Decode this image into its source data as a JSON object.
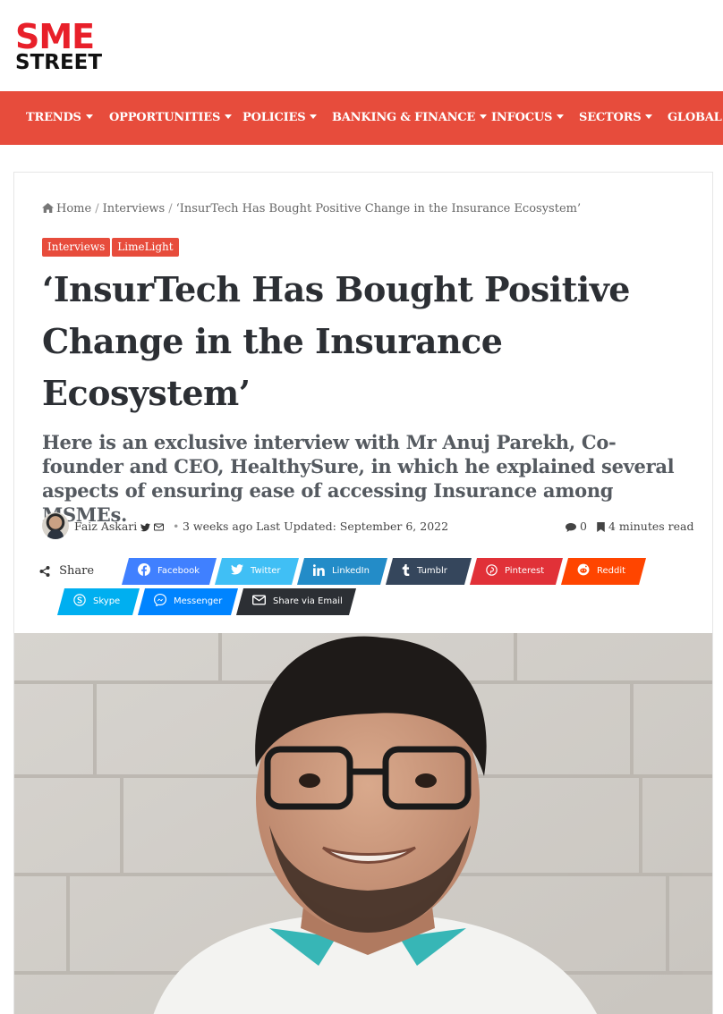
{
  "logo": {
    "line1": "SME",
    "line2": "STREET"
  },
  "nav": {
    "items": [
      {
        "label": "TRENDS"
      },
      {
        "label": "OPPORTUNITIES"
      },
      {
        "label": "POLICIES"
      },
      {
        "label": "BANKING & FINANCE"
      },
      {
        "label": "INFOCUS"
      },
      {
        "label": "SECTORS"
      },
      {
        "label": "GLOBAL"
      }
    ]
  },
  "breadcrumb": {
    "home": "Home",
    "section": "Interviews",
    "current": "‘InsurTech Has Bought Positive Change in the Insurance Ecosystem’",
    "separator": "/"
  },
  "categories": [
    "Interviews",
    "LimeLight"
  ],
  "article": {
    "title": "‘InsurTech Has Bought Positive Change in the Insurance Ecosystem’",
    "subtitle": "Here is an exclusive interview with Mr Anuj Parekh, Co-founder and CEO, HealthySure, in which he explained several aspects of ensuring ease of accessing Insurance among MSMEs."
  },
  "meta": {
    "author": "Faiz Askari",
    "date": "3 weeks ago",
    "last_updated": "Last Updated: September 6, 2022",
    "comments": "0",
    "read_time": "4 minutes read"
  },
  "share": {
    "label": "Share",
    "buttons": [
      {
        "label": "Facebook",
        "color": "#4080ff"
      },
      {
        "label": "Twitter",
        "color": "#40bff5"
      },
      {
        "label": "LinkedIn",
        "color": "#238cc8"
      },
      {
        "label": "Tumblr",
        "color": "#35465c"
      },
      {
        "label": "Pinterest",
        "color": "#e13138"
      },
      {
        "label": "Reddit",
        "color": "#ff4500"
      },
      {
        "label": "Skype",
        "color": "#00aff0"
      },
      {
        "label": "Messenger",
        "color": "#0084ff"
      },
      {
        "label": "Share via Email",
        "color": "#2c2f34"
      }
    ]
  },
  "colors": {
    "accent": "#e74c3c",
    "logo_red": "#e8202a"
  }
}
